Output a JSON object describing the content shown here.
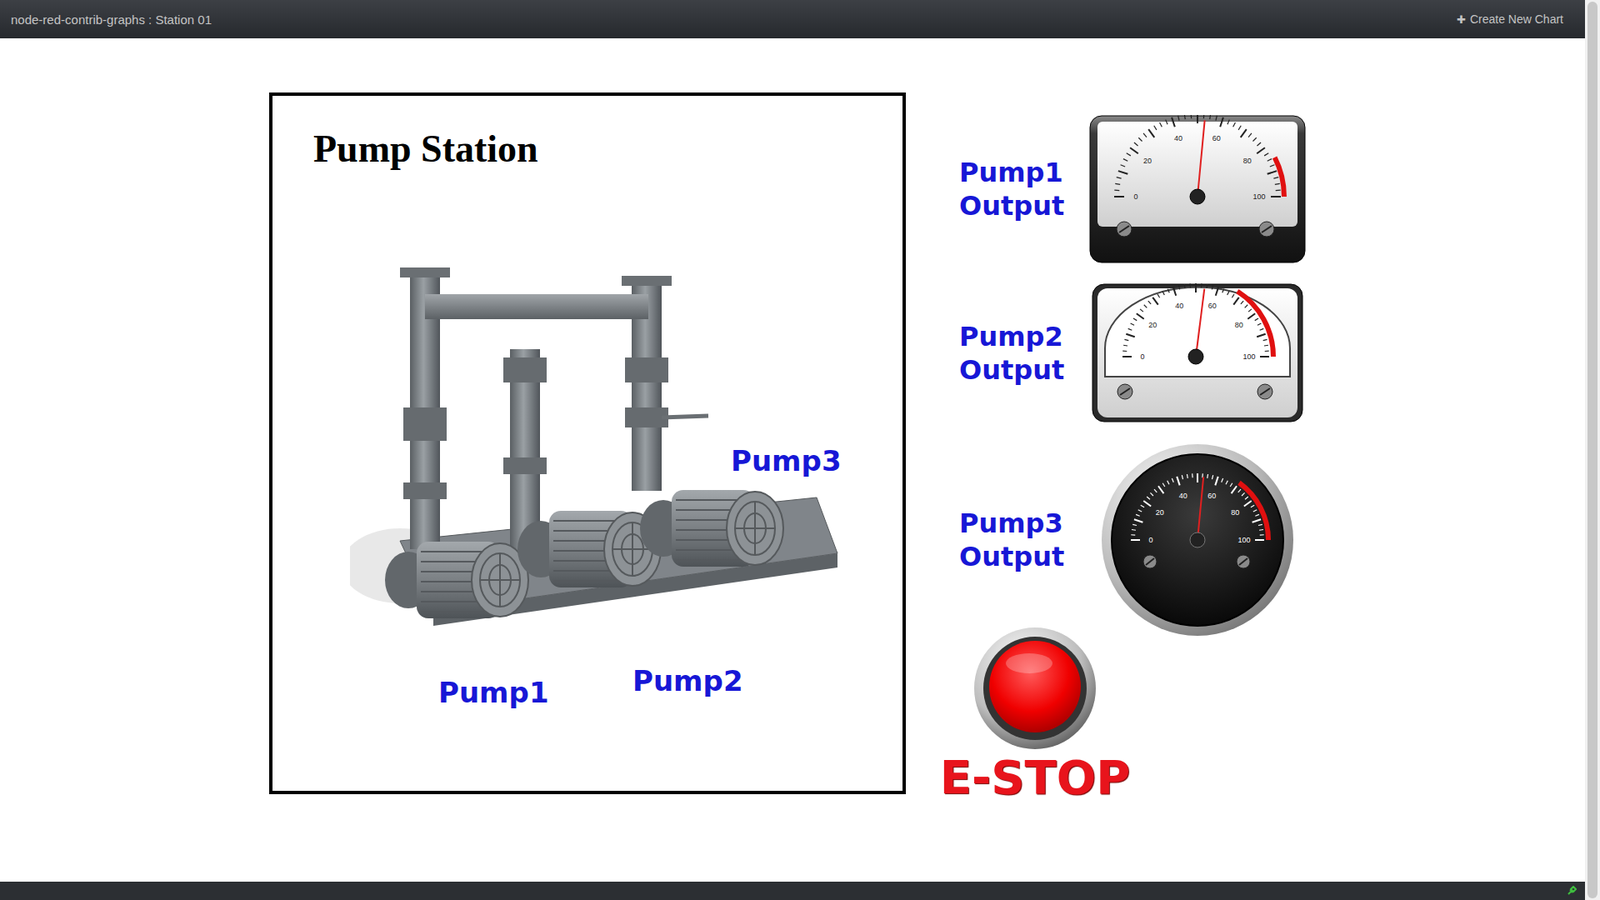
{
  "window": {
    "title": "node-red-contrib-graphs : Station 01"
  },
  "toolbar": {
    "create_button": {
      "icon": "✚",
      "label": "Create New Chart"
    }
  },
  "station": {
    "title": "Pump Station",
    "pump_labels": [
      "Pump1",
      "Pump2",
      "Pump3"
    ]
  },
  "gauges": [
    {
      "label_lines": [
        "Pump1",
        "Output"
      ],
      "kind": "panel-dark",
      "level": 0.53,
      "redzone": 0.85,
      "ticks": [
        "0",
        "20",
        "40",
        "60",
        "80",
        "100"
      ]
    },
    {
      "label_lines": [
        "Pump2",
        "Output"
      ],
      "kind": "panel-light",
      "level": 0.54,
      "redzone": 0.68,
      "ticks": [
        "0",
        "20",
        "40",
        "60",
        "80",
        "100"
      ]
    },
    {
      "label_lines": [
        "Pump3",
        "Output"
      ],
      "kind": "round-dark",
      "level": 0.53,
      "redzone": 0.7,
      "ticks": [
        "0",
        "20",
        "40",
        "60",
        "80",
        "100"
      ]
    }
  ],
  "estop": {
    "label": "E-STOP"
  },
  "status_bar": {
    "connected": true,
    "color": "#3fbf3f"
  }
}
